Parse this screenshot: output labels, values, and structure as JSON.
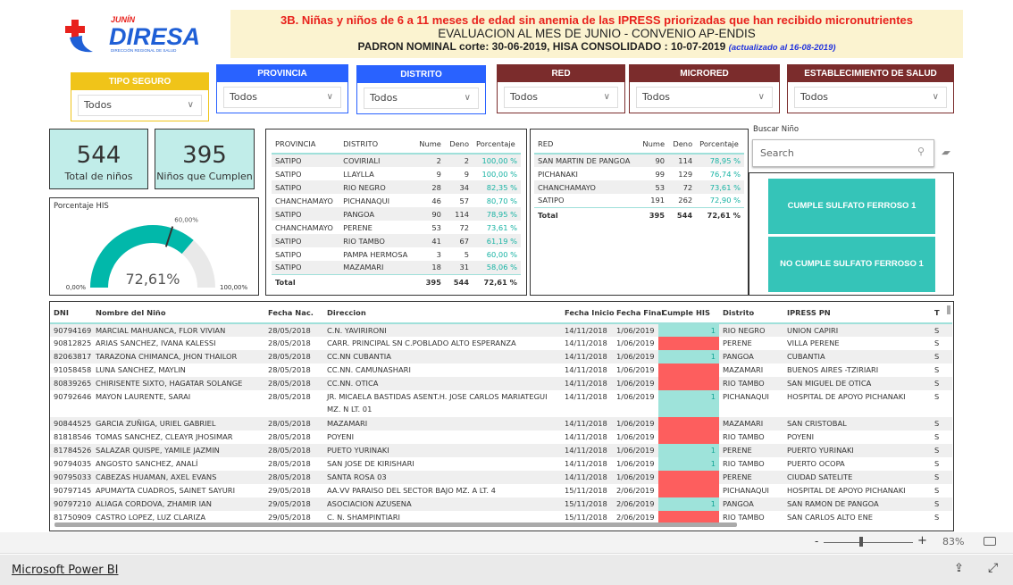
{
  "logo": {
    "brand_top": "JUNÍN",
    "brand": "DIRESA",
    "brand_sub": "DIRECCIÓN REGIONAL DE SALUD"
  },
  "header": {
    "line1": "3B. Niñas y niños de 6 a 11 meses de edad sin anemia de las IPRESS priorizadas que han recibido micronutrientes",
    "line2": "EVALUACION AL MES DE JUNIO - CONVENIO AP-ENDIS",
    "line3": "PADRON NOMINAL corte: 30-06-2019,  HISA CONSOLIDADO : 10-07-2019 ",
    "line3_note": "(actualizado al  16-08-2019)"
  },
  "filters": [
    {
      "label": "TIPO SEGURO",
      "value": "Todos",
      "color": "#f0c419"
    },
    {
      "label": "PROVINCIA",
      "value": "Todos",
      "color": "#2962ff"
    },
    {
      "label": "DISTRITO",
      "value": "Todos",
      "color": "#2962ff"
    },
    {
      "label": "RED",
      "value": "Todos",
      "color": "#7b2c2c"
    },
    {
      "label": "MICRORED",
      "value": "Todos",
      "color": "#7b2c2c"
    },
    {
      "label": "ESTABLECIMIENTO DE SALUD",
      "value": "Todos",
      "color": "#7b2c2c"
    }
  ],
  "cards": [
    {
      "value": "544",
      "label": "Total de niños"
    },
    {
      "value": "395",
      "label": "Niños que Cumplen"
    }
  ],
  "gauge": {
    "title": "Porcentaje HIS",
    "value": 72.61,
    "value_label": "72,61%",
    "target": 60,
    "target_label": "60,00%",
    "min_label": "0,00%",
    "max_label": "100,00%",
    "fill": "#01b8aa",
    "track": "#e9e9e9"
  },
  "table_distrito": {
    "headers": [
      "PROVINCIA",
      "DISTRITO",
      "Nume",
      "Deno",
      "Porcentaje"
    ],
    "rows": [
      [
        "SATIPO",
        "COVIRIALI",
        "2",
        "2",
        "100,00 %"
      ],
      [
        "SATIPO",
        "LLAYLLA",
        "9",
        "9",
        "100,00 %"
      ],
      [
        "SATIPO",
        "RIO NEGRO",
        "28",
        "34",
        "82,35 %"
      ],
      [
        "CHANCHAMAYO",
        "PICHANAQUI",
        "46",
        "57",
        "80,70 %"
      ],
      [
        "SATIPO",
        "PANGOA",
        "90",
        "114",
        "78,95 %"
      ],
      [
        "CHANCHAMAYO",
        "PERENE",
        "53",
        "72",
        "73,61 %"
      ],
      [
        "SATIPO",
        "RIO TAMBO",
        "41",
        "67",
        "61,19 %"
      ],
      [
        "SATIPO",
        "PAMPA HERMOSA",
        "3",
        "5",
        "60,00 %"
      ],
      [
        "SATIPO",
        "MAZAMARI",
        "18",
        "31",
        "58,06 %"
      ]
    ],
    "total": [
      "Total",
      "",
      "395",
      "544",
      "72,61 %"
    ]
  },
  "table_red": {
    "headers": [
      "RED",
      "Nume",
      "Deno",
      "Porcentaje"
    ],
    "rows": [
      [
        "SAN MARTIN DE PANGOA",
        "90",
        "114",
        "78,95 %"
      ],
      [
        "PICHANAKI",
        "99",
        "129",
        "76,74 %"
      ],
      [
        "CHANCHAMAYO",
        "53",
        "72",
        "73,61 %"
      ],
      [
        "SATIPO",
        "191",
        "262",
        "72,90 %"
      ]
    ],
    "total": [
      "Total",
      "395",
      "544",
      "72,61 %"
    ]
  },
  "search": {
    "label": "Buscar Niño",
    "placeholder": "Search"
  },
  "buttons": [
    "CUMPLE SULFATO FERROSO 1",
    "NO CUMPLE SULFATO FERROSO 1"
  ],
  "main_table": {
    "headers": [
      "DNI",
      "Nombre del Niño",
      "Fecha Nac.",
      "Direccion",
      "Fecha Inicio",
      "Fecha Final",
      "Cumple HIS",
      "Distrito",
      "IPRESS PN",
      "T"
    ],
    "rows": [
      [
        "90794169",
        "MARCIAL MAHUANCA, FLOR VIVIAN",
        "28/05/2018",
        "C.N. YAVIRIRONI",
        "14/11/2018",
        "1/06/2019",
        "1",
        "RIO NEGRO",
        "UNION CAPIRI",
        "S"
      ],
      [
        "90812825",
        "ARIAS SANCHEZ, IVANA KALESSI",
        "28/05/2018",
        "CARR. PRINCIPAL SN C.POBLADO ALTO ESPERANZA",
        "14/11/2018",
        "1/06/2019",
        "",
        "PERENE",
        "VILLA PERENE",
        "S"
      ],
      [
        "82063817",
        "TARAZONA CHIMANCA, JHON THAILOR",
        "28/05/2018",
        "CC.NN CUBANTIA",
        "14/11/2018",
        "1/06/2019",
        "1",
        "PANGOA",
        "CUBANTIA",
        "S"
      ],
      [
        "91058458",
        "LUNA SANCHEZ, MAYLIN",
        "28/05/2018",
        "CC.NN. CAMUNASHARI",
        "14/11/2018",
        "1/06/2019",
        "",
        "MAZAMARI",
        "BUENOS AIRES -TZIRIARI",
        "S"
      ],
      [
        "80839265",
        "CHIRISENTE SIXTO, HAGATAR SOLANGE",
        "28/05/2018",
        "CC.NN. OTICA",
        "14/11/2018",
        "1/06/2019",
        "",
        "RIO TAMBO",
        "SAN MIGUEL DE OTICA",
        "S"
      ],
      [
        "90792646",
        "MAYON LAURENTE, SARAI",
        "28/05/2018",
        "JR. MICAELA BASTIDAS ASENT.H. JOSE CARLOS MARIATEGUI MZ. N LT. 01",
        "14/11/2018",
        "1/06/2019",
        "1",
        "PICHANAQUI",
        "HOSPITAL DE APOYO PICHANAKI",
        "S"
      ],
      [
        "90844525",
        "GARCIA ZUÑIGA, URIEL GABRIEL",
        "28/05/2018",
        "MAZAMARI",
        "14/11/2018",
        "1/06/2019",
        "",
        "MAZAMARI",
        "SAN CRISTOBAL",
        "S"
      ],
      [
        "81818546",
        "TOMAS SANCHEZ, CLEAYR JHOSIMAR",
        "28/05/2018",
        "POYENI",
        "14/11/2018",
        "1/06/2019",
        "",
        "RIO TAMBO",
        "POYENI",
        "S"
      ],
      [
        "81784526",
        "SALAZAR QUISPE, YAMILE JAZMIN",
        "28/05/2018",
        "PUETO YURINAKI",
        "14/11/2018",
        "1/06/2019",
        "1",
        "PERENE",
        "PUERTO YURINAKI",
        "S"
      ],
      [
        "90794035",
        "ANGOSTO SANCHEZ, ANALÍ",
        "28/05/2018",
        "SAN JOSE DE KIRISHARI",
        "14/11/2018",
        "1/06/2019",
        "1",
        "RIO TAMBO",
        "PUERTO OCOPA",
        "S"
      ],
      [
        "90795033",
        "CABEZAS HUAMAN, AXEL EVANS",
        "28/05/2018",
        "SANTA ROSA 03",
        "14/11/2018",
        "1/06/2019",
        "",
        "PERENE",
        "CIUDAD SATELITE",
        "S"
      ],
      [
        "90797145",
        "APUMAYTA CUADROS, SAINET SAYURI",
        "29/05/2018",
        "AA.VV PARAISO DEL SECTOR BAJO MZ. A LT. 4",
        "15/11/2018",
        "2/06/2019",
        "",
        "PICHANAQUI",
        "HOSPITAL DE APOYO PICHANAKI",
        "S"
      ],
      [
        "90797210",
        "ALIAGA CORDOVA, ZHAMIR IAN",
        "29/05/2018",
        "ASOCIACION AZUSENA",
        "15/11/2018",
        "2/06/2019",
        "1",
        "PANGOA",
        "SAN RAMON DE PANGOA",
        "S"
      ],
      [
        "81750909",
        "CASTRO LOPEZ, LUZ CLARIZA",
        "29/05/2018",
        "C. N. SHAMPINTIARI",
        "15/11/2018",
        "2/06/2019",
        "",
        "RIO TAMBO",
        "SAN CARLOS ALTO ENE",
        "S"
      ]
    ]
  },
  "colors": {
    "cumple": "#9ee3da",
    "no_cumple": "#fd5e5e",
    "accent": "#35c4b8"
  },
  "zoom": {
    "minus": "-",
    "plus": "+",
    "level": "83%",
    "slider_fraction": 0.42
  },
  "footer": {
    "link": "Microsoft Power BI"
  }
}
